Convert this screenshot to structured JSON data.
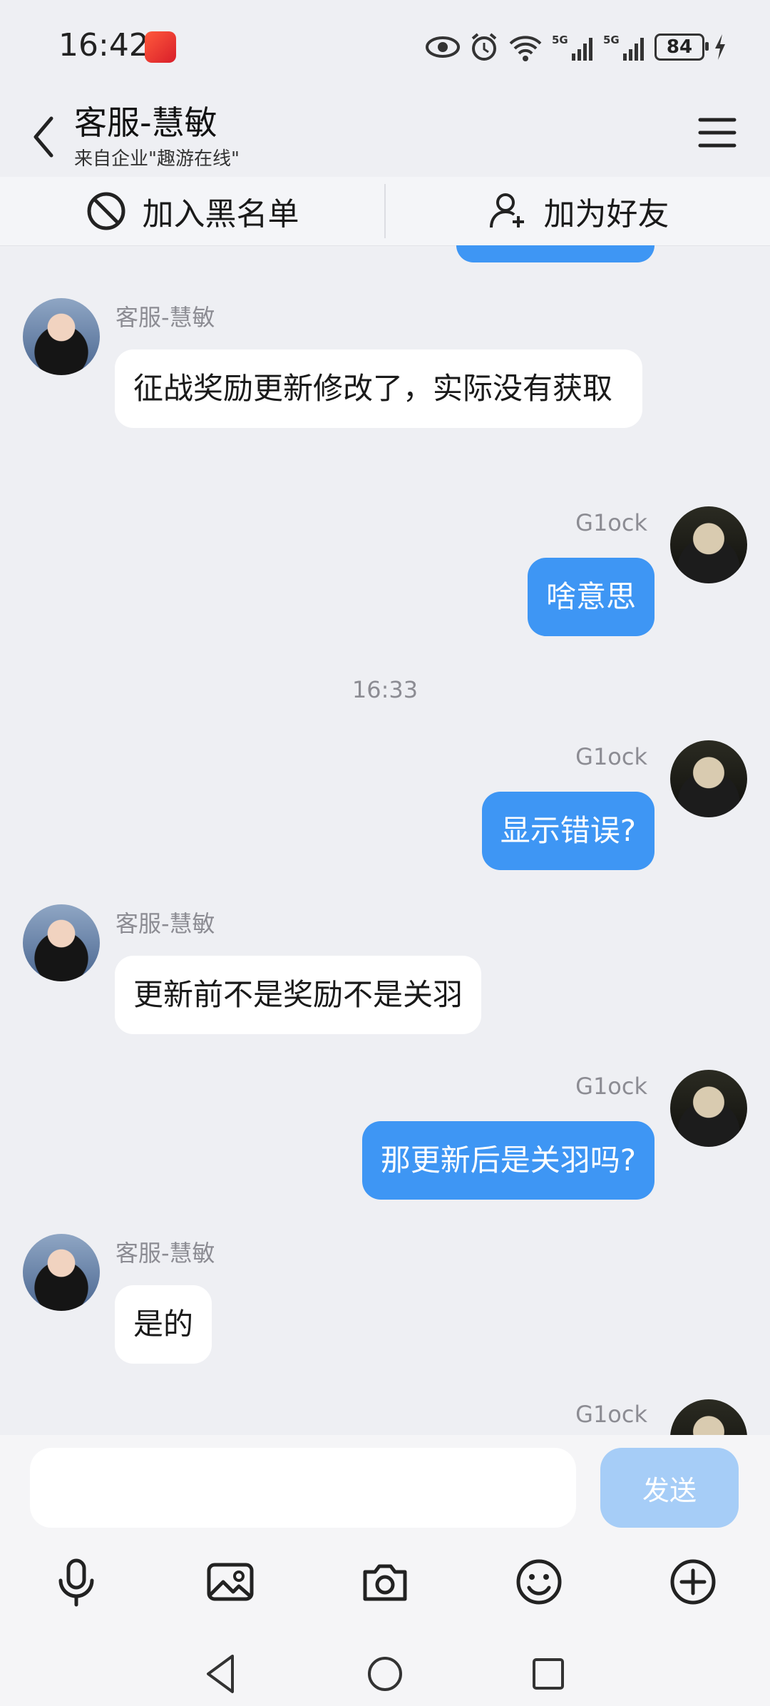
{
  "status": {
    "time": "16:42",
    "battery": "84",
    "network": "5G"
  },
  "header": {
    "title": "客服-慧敏",
    "subtitle": "来自企业\"趣游在线\""
  },
  "actions": {
    "block_label": "加入黑名单",
    "add_friend_label": "加为好友"
  },
  "messages": [
    {
      "sender": "客服-慧敏",
      "text": "征战奖励更新修改了，实际没有获取"
    },
    {
      "sender": "G1ock",
      "text": "啥意思"
    },
    {
      "timestamp": "16:33"
    },
    {
      "sender": "G1ock",
      "text": "显示错误?"
    },
    {
      "sender": "客服-慧敏",
      "text": "更新前不是奖励不是关羽"
    },
    {
      "sender": "G1ock",
      "text": "那更新后是关羽吗?"
    },
    {
      "sender": "客服-慧敏",
      "text": "是的"
    },
    {
      "sender": "G1ock",
      "text": ""
    }
  ],
  "composer": {
    "placeholder": "",
    "send_label": "发送"
  },
  "toolbar_icons": [
    "microphone-icon",
    "image-icon",
    "camera-icon",
    "emoji-icon",
    "plus-icon"
  ],
  "colors": {
    "outgoing_bubble": "#3e96f4",
    "incoming_bubble": "#ffffff",
    "background": "#eeeff3",
    "send_button": "#a6cdf7"
  }
}
